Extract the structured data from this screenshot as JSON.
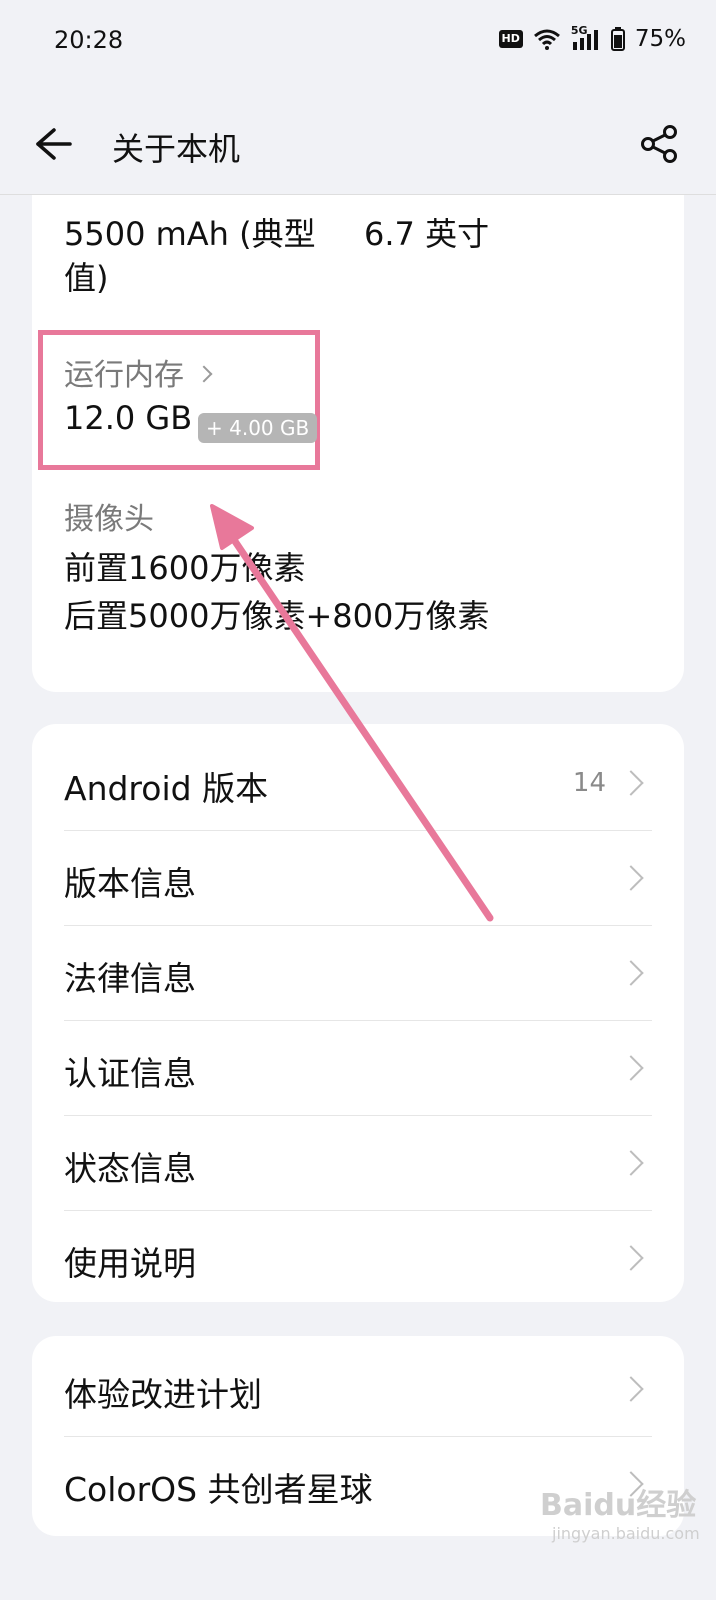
{
  "status": {
    "time": "20:28",
    "hd": "HD",
    "net": "5G",
    "battery": "75%"
  },
  "appbar": {
    "title": "关于本机",
    "back_icon": "arrow-left-icon",
    "share_icon": "share-icon"
  },
  "specs": {
    "battery_value": "5500 mAh (典型值)",
    "screen_value": "6.7 英寸",
    "ram_label": "运行内存",
    "ram_value": "12.0 GB",
    "ram_extra": "+ 4.00 GB",
    "camera_label": "摄像头",
    "camera_front": "前置1600万像素",
    "camera_rear": "后置5000万像素+800万像素"
  },
  "system_list": [
    {
      "label": "Android 版本",
      "value": "14"
    },
    {
      "label": "版本信息",
      "value": ""
    },
    {
      "label": "法律信息",
      "value": ""
    },
    {
      "label": "认证信息",
      "value": ""
    },
    {
      "label": "状态信息",
      "value": ""
    },
    {
      "label": "使用说明",
      "value": ""
    }
  ],
  "extra_list": [
    {
      "label": "体验改进计划"
    },
    {
      "label": "ColorOS 共创者星球"
    }
  ],
  "watermark": {
    "main": "Baidu经验",
    "sub": "jingyan.baidu.com"
  },
  "colors": {
    "highlight": "#e8789a",
    "arrow": "#e8789a",
    "background": "#f1f2f6"
  }
}
